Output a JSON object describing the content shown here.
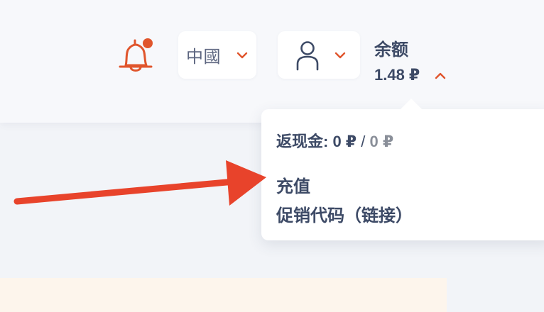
{
  "header": {
    "notifications": {
      "icon": "bell-icon",
      "badge_color": "#e0552c"
    },
    "language": {
      "selected": "中國",
      "chevron_icon": "chevron-down-icon"
    },
    "user_menu": {
      "icon": "user-icon",
      "chevron_icon": "chevron-down-icon"
    },
    "balance": {
      "title": "余额",
      "amount": "1.48 ₽",
      "chevron_icon": "chevron-up-icon"
    }
  },
  "balance_dropdown": {
    "cashback_label": "返现金:",
    "cashback_value": "0 ₽",
    "cashback_separator": "/",
    "cashback_pending": "0 ₽",
    "items": [
      {
        "label": "充值"
      },
      {
        "label": "促销代码（链接）"
      }
    ]
  },
  "annotation": {
    "icon": "red-arrow-icon",
    "color": "#e8432b"
  },
  "colors": {
    "accent": "#e0552c",
    "text": "#3d4a66",
    "muted": "#8a8f99",
    "background": "#f2f4f8"
  }
}
